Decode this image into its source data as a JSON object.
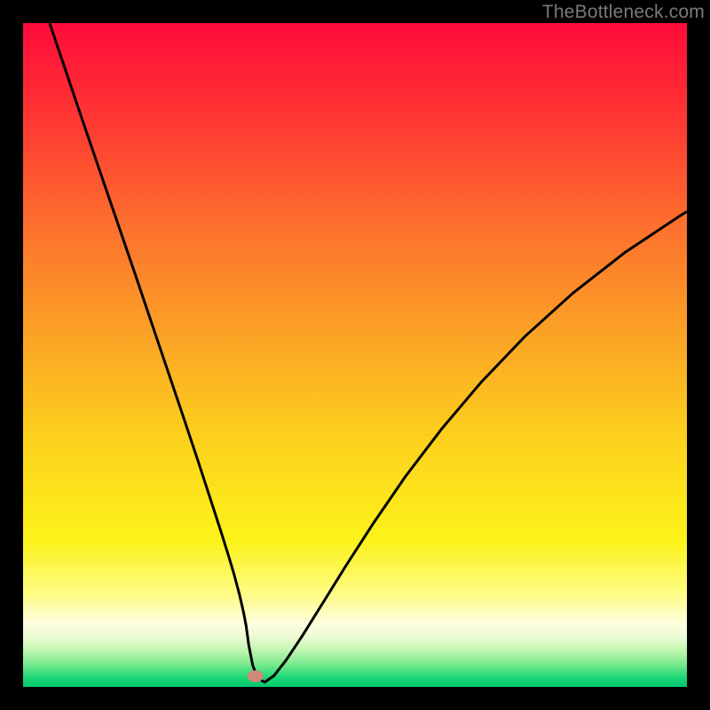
{
  "watermark": "TheBottleneck.com",
  "chart_data": {
    "type": "line",
    "title": "",
    "xlabel": "",
    "ylabel": "",
    "xlim": [
      0,
      100
    ],
    "ylim": [
      0,
      100
    ],
    "background": {
      "type": "vertical-gradient",
      "stops": [
        {
          "offset": 0.0,
          "color": "#ff0b3a"
        },
        {
          "offset": 0.12,
          "color": "#ff2f33"
        },
        {
          "offset": 0.3,
          "color": "#fd6e2e"
        },
        {
          "offset": 0.48,
          "color": "#fba625"
        },
        {
          "offset": 0.62,
          "color": "#fccf1d"
        },
        {
          "offset": 0.78,
          "color": "#fcf31a"
        },
        {
          "offset": 0.86,
          "color": "#fdfc84"
        },
        {
          "offset": 0.905,
          "color": "#fefde0"
        },
        {
          "offset": 0.925,
          "color": "#ecfbd4"
        },
        {
          "offset": 0.945,
          "color": "#c0f6b0"
        },
        {
          "offset": 0.965,
          "color": "#7ceb8f"
        },
        {
          "offset": 0.985,
          "color": "#1fd877"
        },
        {
          "offset": 1.0,
          "color": "#00c86e"
        }
      ]
    },
    "series": [
      {
        "name": "bottleneck-curve",
        "stroke": "#000000",
        "strokeWidth": 3,
        "x": [
          4.0,
          6.5,
          9.0,
          11.5,
          14.0,
          16.5,
          19.0,
          21.5,
          24.0,
          26.5,
          29.0,
          30.0,
          31.0,
          31.8,
          32.6,
          33.2,
          33.6,
          34.0,
          34.6,
          35.4,
          36.4,
          37.8,
          39.6,
          42.0,
          45.0,
          48.6,
          52.8,
          57.6,
          63.0,
          69.0,
          75.6,
          82.8,
          90.6,
          99.0,
          100.0
        ],
        "y": [
          100.0,
          92.6,
          85.2,
          77.9,
          70.6,
          63.3,
          55.9,
          48.5,
          41.1,
          33.6,
          25.9,
          22.8,
          19.6,
          16.9,
          13.9,
          11.3,
          9.2,
          6.3,
          3.2,
          1.3,
          0.7,
          1.7,
          4.0,
          7.6,
          12.4,
          18.2,
          24.7,
          31.7,
          38.8,
          45.9,
          52.8,
          59.3,
          65.4,
          71.0,
          71.6
        ]
      }
    ],
    "marker": {
      "name": "optimal-point",
      "x": 35.0,
      "y": 1.6,
      "rx": 1.2,
      "ry": 0.9,
      "fill": "#d08a78"
    }
  }
}
